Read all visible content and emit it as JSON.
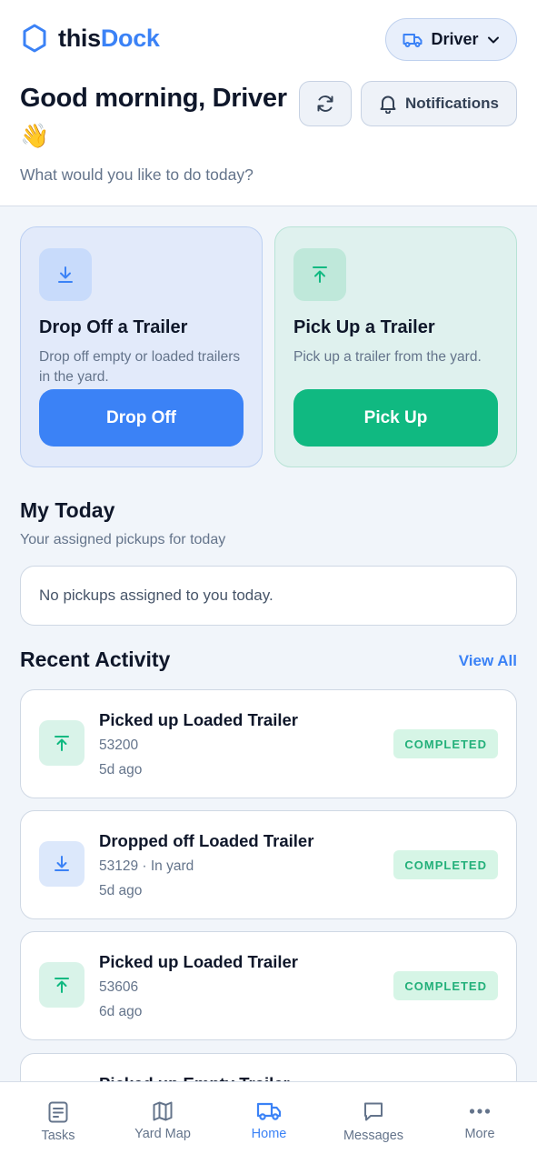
{
  "brand": {
    "name_part1": "this",
    "name_part2": "Dock"
  },
  "role_selector": {
    "label": "Driver"
  },
  "greeting": {
    "title": "Good morning, Driver",
    "emoji": "👋",
    "subtitle": "What would you like to do today?"
  },
  "header_actions": {
    "notifications_label": "Notifications"
  },
  "actions": {
    "drop_off": {
      "title": "Drop Off a Trailer",
      "description": "Drop off empty or loaded trailers in the yard.",
      "button": "Drop Off"
    },
    "pick_up": {
      "title": "Pick Up a Trailer",
      "description": "Pick up a trailer from the yard.",
      "button": "Pick Up"
    }
  },
  "my_today": {
    "title": "My Today",
    "subtitle": "Your assigned pickups for today",
    "empty": "No pickups assigned to you today."
  },
  "recent_activity": {
    "title": "Recent Activity",
    "view_all": "View All",
    "items": [
      {
        "title": "Picked up Loaded Trailer",
        "meta": "53200",
        "time": "5d ago",
        "status": "COMPLETED",
        "type": "pickup"
      },
      {
        "title": "Dropped off Loaded Trailer",
        "meta": "53129 · In yard",
        "time": "5d ago",
        "status": "COMPLETED",
        "type": "dropoff"
      },
      {
        "title": "Picked up Loaded Trailer",
        "meta": "53606",
        "time": "6d ago",
        "status": "COMPLETED",
        "type": "pickup"
      },
      {
        "title": "Picked up Empty Trailer"
      }
    ]
  },
  "bottom_nav": [
    {
      "label": "Tasks",
      "icon": "tasks-icon"
    },
    {
      "label": "Yard Map",
      "icon": "map-icon"
    },
    {
      "label": "Home",
      "icon": "truck-icon",
      "active": true
    },
    {
      "label": "Messages",
      "icon": "message-icon"
    },
    {
      "label": "More",
      "icon": "more-icon"
    }
  ],
  "colors": {
    "accent": "#3b82f6",
    "success": "#10b981",
    "badge_text": "#23b07a"
  }
}
